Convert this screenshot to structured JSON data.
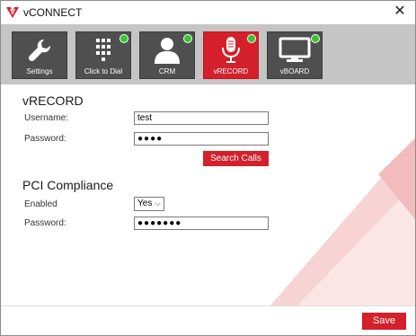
{
  "window": {
    "title": "vCONNECT",
    "close_glyph": "✕"
  },
  "toolbar": {
    "tiles": [
      {
        "label": "Settings",
        "icon": "wrench-icon",
        "active": false,
        "online": false
      },
      {
        "label": "Click to Dial",
        "icon": "dialpad-icon",
        "active": false,
        "online": true
      },
      {
        "label": "CRM",
        "icon": "user-icon",
        "active": false,
        "online": true
      },
      {
        "label": "vRECORD",
        "icon": "microphone-icon",
        "active": true,
        "online": true
      },
      {
        "label": "vBOARD",
        "icon": "monitor-icon",
        "active": false,
        "online": true
      }
    ]
  },
  "vrecord": {
    "heading": "vRECORD",
    "username_label": "Username:",
    "username_value": "test",
    "password_label": "Password:",
    "password_value": "●●●●",
    "search_button": "Search Calls"
  },
  "pci": {
    "heading": "PCI Compliance",
    "enabled_label": "Enabled",
    "enabled_value": "Yes",
    "password_label": "Password:",
    "password_value": "●●●●●●●"
  },
  "footer": {
    "save_button": "Save"
  },
  "colors": {
    "accent": "#d3202b",
    "tile": "#4f4f4f",
    "toolbar": "#c5c5c5",
    "status_online": "#37c62d"
  }
}
